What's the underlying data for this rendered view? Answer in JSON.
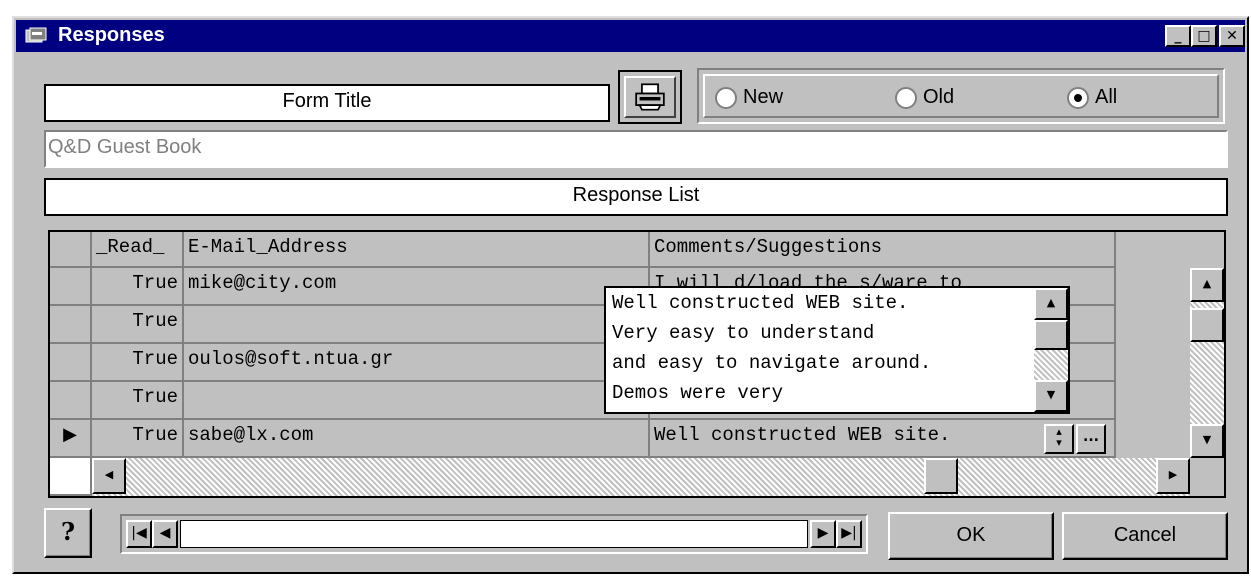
{
  "window": {
    "title": "Responses",
    "minimize_glyph": "_",
    "maximize_glyph": "□",
    "close_glyph": "✕"
  },
  "form": {
    "title_label": "Form Title",
    "title_value": "Q&D Guest Book",
    "response_list_label": "Response List"
  },
  "filter": {
    "options": [
      {
        "label": "New",
        "selected": false
      },
      {
        "label": "Old",
        "selected": false
      },
      {
        "label": "All",
        "selected": true
      }
    ]
  },
  "grid": {
    "columns": [
      "_Read_",
      "E-Mail_Address",
      "Comments/Suggestions"
    ],
    "rows": [
      {
        "read": "True",
        "email": "mike@city.com",
        "comment": "I will d/load the s/ware to"
      },
      {
        "read": "True",
        "email": "",
        "comment": ""
      },
      {
        "read": "True",
        "email": "oulos@soft.ntua.gr",
        "comment": ""
      },
      {
        "read": "True",
        "email": "",
        "comment": ""
      },
      {
        "read": "True",
        "email": "sabe@lx.com",
        "comment": "Well constructed WEB site."
      }
    ],
    "current_row_marker": "▶",
    "ellipsis_label": "..."
  },
  "comment_popup": {
    "lines": [
      "Well constructed WEB site.",
      "Very easy to understand",
      "and easy to navigate around.",
      "Demos were very"
    ]
  },
  "buttons": {
    "ok": "OK",
    "cancel": "Cancel",
    "help_glyph": "?"
  },
  "icons": {
    "print": "printer-icon",
    "help": "question-icon"
  }
}
